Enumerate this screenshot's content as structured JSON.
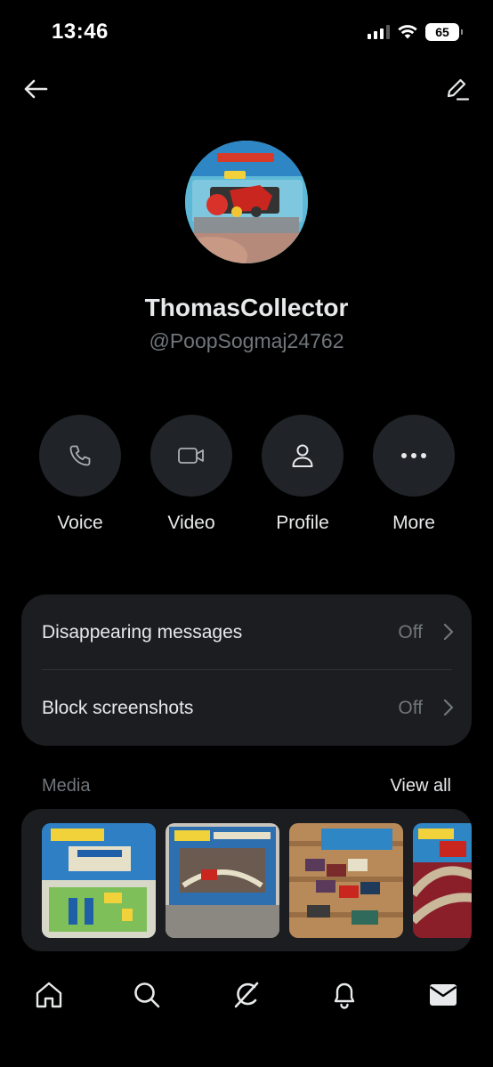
{
  "status_bar": {
    "time": "13:46",
    "battery": "65"
  },
  "nav": {
    "back_icon": "arrow-left-icon",
    "edit_icon": "pencil-icon"
  },
  "profile": {
    "display_name": "ThomasCollector",
    "handle": "@PoopSogmaj24762"
  },
  "actions": [
    {
      "label": "Voice",
      "icon": "phone-icon"
    },
    {
      "label": "Video",
      "icon": "video-camera-icon"
    },
    {
      "label": "Profile",
      "icon": "person-icon"
    },
    {
      "label": "More",
      "icon": "more-dots-icon"
    }
  ],
  "settings": [
    {
      "title": "Disappearing messages",
      "value": "Off"
    },
    {
      "title": "Block screenshots",
      "value": "Off"
    }
  ],
  "media": {
    "title": "Media",
    "view_all": "View all"
  },
  "tab_bar": [
    {
      "icon": "home-icon"
    },
    {
      "icon": "search-icon"
    },
    {
      "icon": "grok-icon"
    },
    {
      "icon": "bell-icon"
    },
    {
      "icon": "envelope-icon"
    }
  ],
  "colors": {
    "background": "#000000",
    "card": "#1b1d20",
    "button_circle": "#202327",
    "primary_text": "#e7e9ea",
    "secondary_text": "#71767b"
  }
}
